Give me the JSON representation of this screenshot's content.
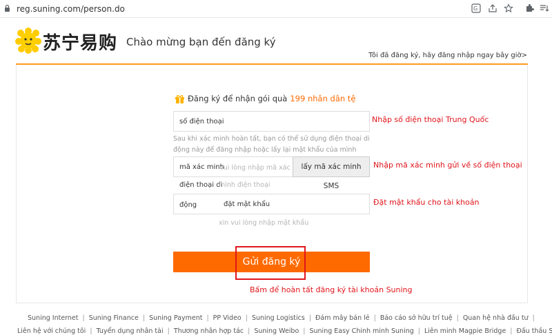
{
  "browser": {
    "url": "reg.suning.com/person.do",
    "icons": [
      "translate-icon",
      "share-icon",
      "star-icon",
      "extensions-icon",
      "reading-list-icon"
    ]
  },
  "header": {
    "logo_text": "苏宁易购",
    "welcome": "Chào mừng bạn đến đăng ký",
    "login_link": "Tôi đã đăng ký, hãy đăng nhập ngay bây giờ>"
  },
  "form": {
    "gift_text": "Đăng ký để nhận gói quà",
    "gift_amount": "199 nhân dân tệ",
    "phone_placeholder": "số điện thoại",
    "phone_hint": "Sau khi xác minh hoàn tất, bạn có thể sử dụng điện thoại di động này để đăng nhập hoặc lấy lại mật khẩu của mình",
    "code_label": "mã xác minh",
    "code_placeholder": "Vui lòng nhập mã xác",
    "sms_button": "lấy mã xác minh SMS",
    "voice_label": "điện thoại di",
    "voice_placeholder": "mình điện thoại",
    "pw_label": "động",
    "pw_placeholder": "đặt mật khẩu",
    "pw_hint": "xin vui lòng nhập mật khẩu",
    "submit": "Gửi đăng ký"
  },
  "annotations": {
    "phone_note": "Nhập số điện thoại Trung Quốc",
    "code_note": "Nhập mã xác minh gửi về số điện thoại",
    "pw_note": "Đặt mật khẩu cho tài khoản",
    "submit_note": "Bấm để hoàn tất đăng ký tài khoản Suning"
  },
  "footer": {
    "row1": [
      "Suning Internet",
      "Suning Finance",
      "Suning Payment",
      "PP Video",
      "Suning Logistics",
      "Đám mây bán lẻ",
      "Báo cáo sở hữu trí tuệ",
      "Quan hệ nhà đầu tư",
      ""
    ],
    "row2": [
      "Liên hệ với chúng tôi",
      "Tuyển dụng nhân tài",
      "Thương nhân hợp tác",
      "Suning Weibo",
      "Suning Easy Chinh minh Suning",
      "Liên minh Magpie Bridge",
      "Đấu thầu Suning"
    ]
  },
  "colors": {
    "accent_orange": "#ff6a00",
    "line_orange": "#ff9a1f",
    "annotation_red": "#e0151b"
  }
}
